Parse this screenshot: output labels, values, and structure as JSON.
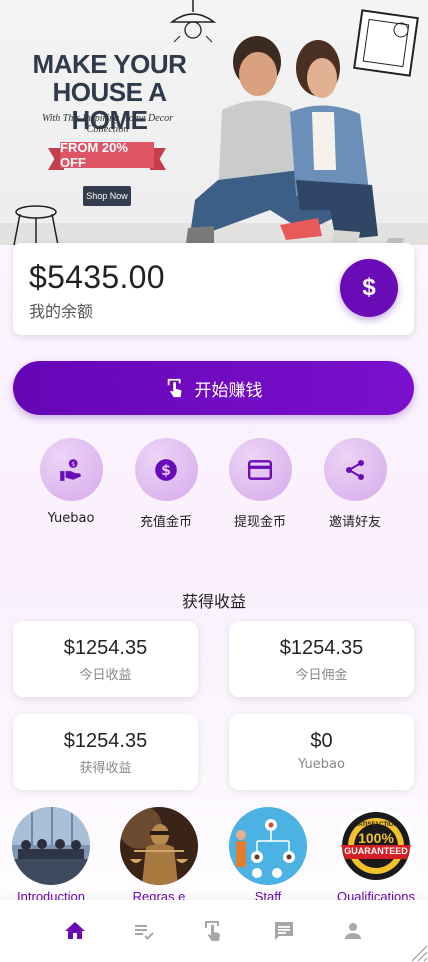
{
  "banner": {
    "title_line1": "MAKE YOUR",
    "title_line2": "HOUSE A HOME",
    "subtitle": "With This Inspiring Home Decor Collection",
    "offer": "FROM 20% OFF",
    "cta": "Shop Now"
  },
  "balance": {
    "amount": "$5435.00",
    "label": "我的余额",
    "button_icon": "$"
  },
  "earn_button": {
    "label": "开始赚钱",
    "icon": "tap-icon"
  },
  "quick_actions": [
    {
      "label": "Yuebao",
      "icon": "hand-coin-icon"
    },
    {
      "label": "充值金币",
      "icon": "dollar-circle-icon"
    },
    {
      "label": "提现金币",
      "icon": "credit-card-icon"
    },
    {
      "label": "邀请好友",
      "icon": "share-icon"
    }
  ],
  "earnings": {
    "title": "获得收益",
    "cards": [
      {
        "value": "$1254.35",
        "label": "今日收益"
      },
      {
        "value": "$1254.35",
        "label": "今日佣金"
      },
      {
        "value": "$1254.35",
        "label": "获得收益"
      },
      {
        "value": "$0",
        "label": "Yuebao"
      }
    ]
  },
  "info_links": [
    {
      "label": "Introduction",
      "icon": "meeting-room-image"
    },
    {
      "label": "Regras e",
      "icon": "justice-statue-image"
    },
    {
      "label": "Staff",
      "icon": "org-chart-image"
    },
    {
      "label": "Qualifications",
      "icon": "satisfaction-badge-image"
    }
  ],
  "nav": [
    {
      "name": "home",
      "icon": "home-icon",
      "active": true
    },
    {
      "name": "tasks",
      "icon": "checklist-icon",
      "active": false
    },
    {
      "name": "tap",
      "icon": "tap-icon",
      "active": false
    },
    {
      "name": "messages",
      "icon": "message-icon",
      "active": false
    },
    {
      "name": "profile",
      "icon": "person-icon",
      "active": false
    }
  ],
  "colors": {
    "primary": "#6a0bb8",
    "accent_light": "#dcb4ee",
    "nav_inactive": "#a7a7a7",
    "offer_red": "#e05565"
  },
  "satisfaction_badge": {
    "top": "SATISFACTION",
    "middle": "100%",
    "bottom": "GUARANTEED"
  }
}
